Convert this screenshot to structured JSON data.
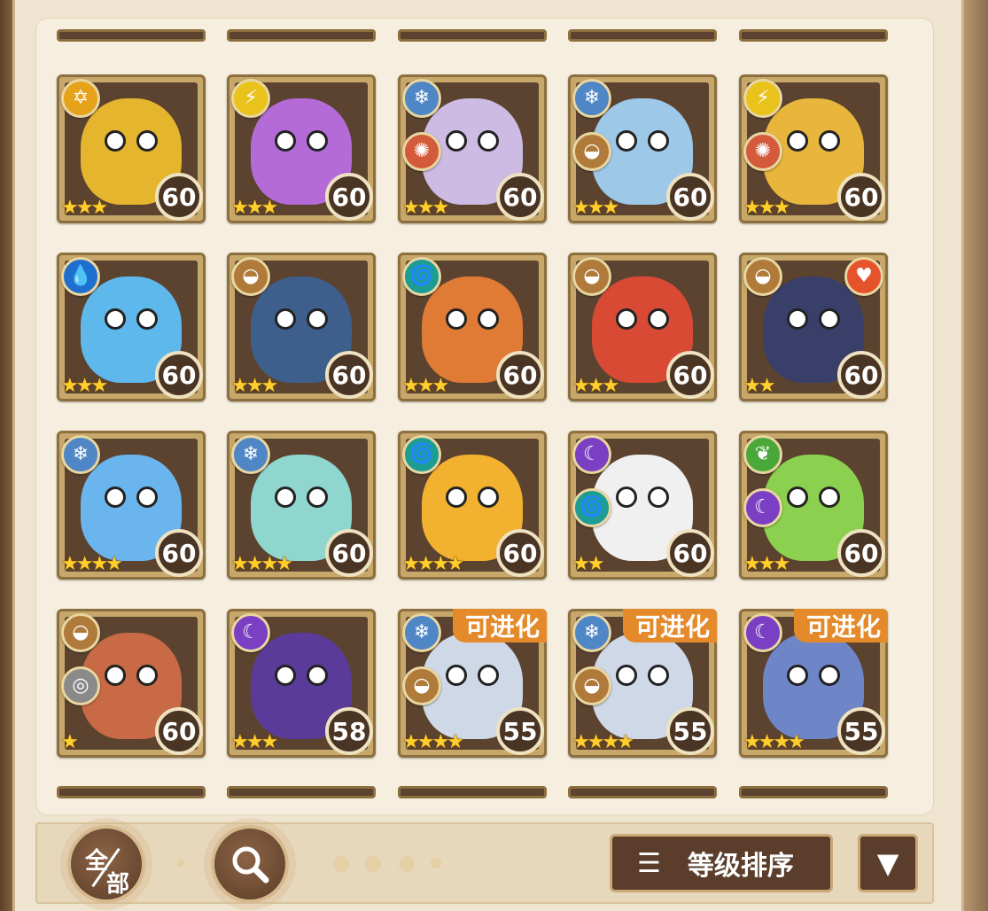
{
  "toolbar": {
    "filter_top": "全",
    "filter_bottom": "部",
    "sort_icon": "☰",
    "sort_label": "等级排序",
    "dropdown_arrow": "▼"
  },
  "colors": {
    "fire": "#d35a3a",
    "earth": "#b07a3a",
    "ice": "#4f86c6",
    "electric": "#e9c21b",
    "water": "#1f6fd0",
    "wind": "#1d9c93",
    "shadow": "#7b3fc4",
    "grass": "#4aa83a",
    "light": "#e7a21b",
    "normal": "#8a8a8a",
    "heart": "#e5532c"
  },
  "monsters": [
    {
      "level": "60",
      "stars": "★★★",
      "elems": [
        "light"
      ],
      "icons": [
        "✡"
      ],
      "art": "#e5b52e"
    },
    {
      "level": "60",
      "stars": "★★★",
      "elems": [
        "electric"
      ],
      "icons": [
        "⚡"
      ],
      "art": "#b46bd8"
    },
    {
      "level": "60",
      "stars": "★★★",
      "elems": [
        "ice",
        "fire"
      ],
      "icons": [
        "❄",
        "✺"
      ],
      "art": "#cdbbe3"
    },
    {
      "level": "60",
      "stars": "★★★",
      "elems": [
        "ice",
        "earth"
      ],
      "icons": [
        "❄",
        "◒"
      ],
      "art": "#9ec8e8"
    },
    {
      "level": "60",
      "stars": "★★★",
      "elems": [
        "electric",
        "fire"
      ],
      "icons": [
        "⚡",
        "✺"
      ],
      "art": "#e8b63c"
    },
    {
      "level": "60",
      "stars": "★★★",
      "elems": [
        "water"
      ],
      "icons": [
        "💧"
      ],
      "art": "#5fb8ec"
    },
    {
      "level": "60",
      "stars": "★★★",
      "elems": [
        "earth"
      ],
      "icons": [
        "◒"
      ],
      "art": "#3e5f8c"
    },
    {
      "level": "60",
      "stars": "★★★",
      "elems": [
        "wind"
      ],
      "icons": [
        "🌀"
      ],
      "art": "#e07b35"
    },
    {
      "level": "60",
      "stars": "★★★",
      "elems": [
        "earth"
      ],
      "icons": [
        "◒"
      ],
      "art": "#d94a35"
    },
    {
      "level": "60",
      "stars": "★★",
      "elems": [
        "earth",
        "heart"
      ],
      "icons": [
        "◒",
        "♥"
      ],
      "art": "#3a3f6a"
    },
    {
      "level": "60",
      "stars": "★★★★",
      "elems": [
        "ice"
      ],
      "icons": [
        "❄"
      ],
      "art": "#6bb5ee"
    },
    {
      "level": "60",
      "stars": "★★★★",
      "elems": [
        "ice"
      ],
      "icons": [
        "❄"
      ],
      "art": "#8fd6cf"
    },
    {
      "level": "60",
      "stars": "★★★★",
      "elems": [
        "wind"
      ],
      "icons": [
        "🌀"
      ],
      "art": "#f2b230"
    },
    {
      "level": "60",
      "stars": "★★",
      "elems": [
        "shadow",
        "wind"
      ],
      "icons": [
        "☾",
        "🌀"
      ],
      "art": "#f0f0f0"
    },
    {
      "level": "60",
      "stars": "★★★",
      "elems": [
        "grass",
        "shadow"
      ],
      "icons": [
        "❦",
        "☾"
      ],
      "art": "#8bd14f"
    },
    {
      "level": "60",
      "stars": "★",
      "elems": [
        "earth",
        "normal"
      ],
      "icons": [
        "◒",
        "◎"
      ],
      "art": "#c76a45"
    },
    {
      "level": "58",
      "stars": "★★★",
      "elems": [
        "shadow"
      ],
      "icons": [
        "☾"
      ],
      "art": "#5a3b9a"
    },
    {
      "level": "55",
      "stars": "★★★★",
      "elems": [
        "ice",
        "earth"
      ],
      "icons": [
        "❄",
        "◒"
      ],
      "art": "#cfd8e6",
      "evolve": "可进化"
    },
    {
      "level": "55",
      "stars": "★★★★",
      "elems": [
        "ice",
        "earth"
      ],
      "icons": [
        "❄",
        "◒"
      ],
      "art": "#cfd8e6",
      "evolve": "可进化"
    },
    {
      "level": "55",
      "stars": "★★★★",
      "elems": [
        "shadow"
      ],
      "icons": [
        "☾"
      ],
      "art": "#6e86c8",
      "evolve": "可进化"
    }
  ]
}
